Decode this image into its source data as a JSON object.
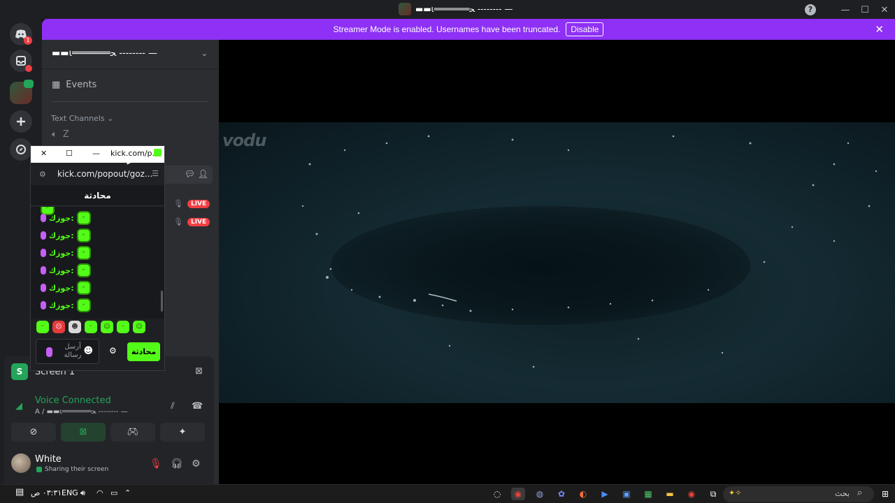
{
  "window": {
    "title": "▬▬ι═══════ﺤ -------- —",
    "help_icon": "?",
    "minimize": "—",
    "maximize": "☐",
    "close": "✕"
  },
  "banner": {
    "text": "Streamer Mode is enabled. Usernames have been truncated.",
    "button": "Disable",
    "close": "✕"
  },
  "rail": {
    "notification_count": "1"
  },
  "sidebar": {
    "server_name": "▬▬ι═══════ﺤ -------- —",
    "events_label": "Events",
    "category": "Text Channels",
    "channel_z": "Z",
    "live_badge": "LIVE"
  },
  "voice_panel": {
    "screen_title": "Screen 1",
    "screen_tile": "S",
    "status": "Voice Connected",
    "channel": "A / ▬▬ι═══════ﺤ -------- —"
  },
  "user": {
    "name": "White",
    "status": "Sharing their screen"
  },
  "popup": {
    "tab_title": "kick.com/p...",
    "url": "kick.com/popout/goz...",
    "header": "محادثة",
    "chat_user": "جوزك:",
    "chat_count": 6,
    "input_placeholder": "أرسل رسالة",
    "send_button": "محادثة"
  },
  "taskbar": {
    "time": "٠٣:٣١ ص",
    "lang": "ENG",
    "search_placeholder": "بحث"
  },
  "colors": {
    "discord_bg": "#2b2d31",
    "rail_bg": "#1e1f22",
    "banner": "#8e30f5",
    "voice_green": "#23a55a",
    "kick_green": "#53fc18",
    "live_red": "#f23f43"
  }
}
